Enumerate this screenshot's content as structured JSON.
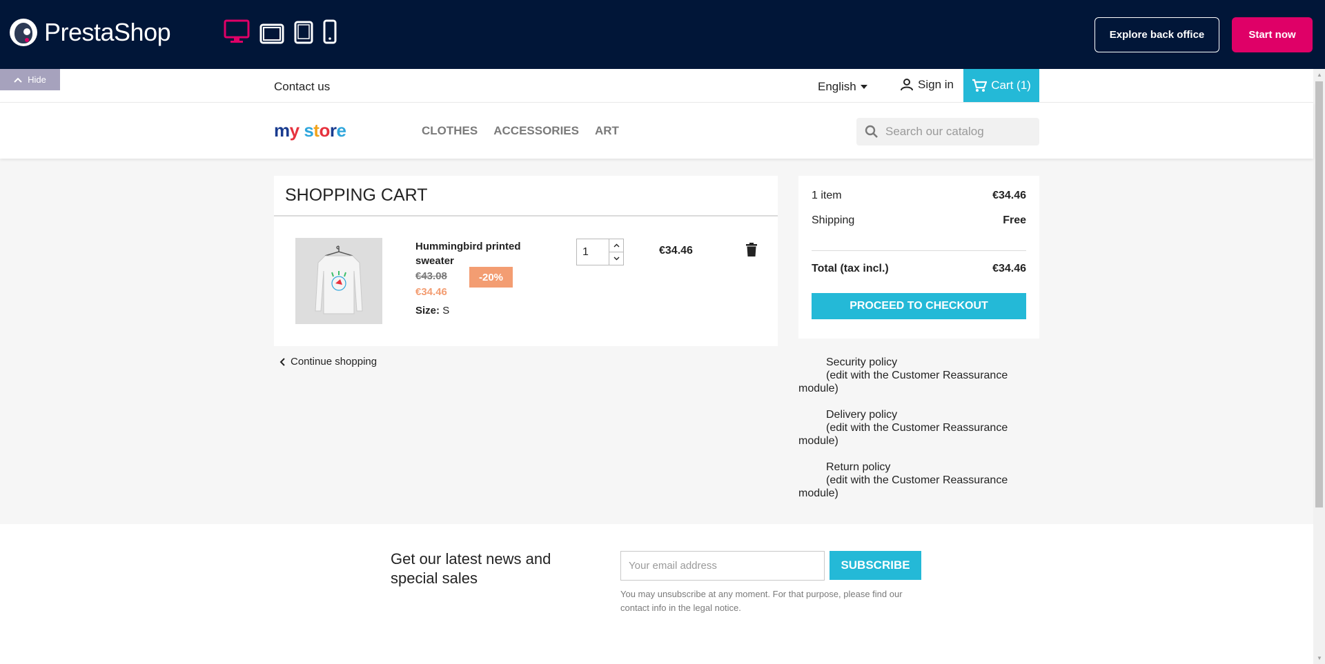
{
  "demo_bar": {
    "brand": "PrestaShop",
    "devices": [
      "desktop-icon",
      "laptop-icon",
      "tablet-icon",
      "mobile-icon"
    ],
    "explore_label": "Explore back office",
    "start_label": "Start now",
    "hide_label": "Hide",
    "colors": {
      "bar": "#011638",
      "accent": "#df0067"
    }
  },
  "header": {
    "contact": "Contact us",
    "language": "English",
    "signin": "Sign in",
    "cart": "Cart (1)",
    "logo_text": "my store",
    "menu": [
      "CLOTHES",
      "ACCESSORIES",
      "ART"
    ],
    "search_placeholder": "Search our catalog",
    "accent": "#24b9d7"
  },
  "cart": {
    "title": "SHOPPING CART",
    "item": {
      "name": "Hummingbird printed sweater",
      "old_price": "€43.08",
      "discount": "-20%",
      "price": "€34.46",
      "size_label": "Size:",
      "size_value": "S",
      "quantity": "1",
      "line_total": "€34.46"
    },
    "continue": "Continue shopping"
  },
  "summary": {
    "items_label": "1 item",
    "items_value": "€34.46",
    "shipping_label": "Shipping",
    "shipping_value": "Free",
    "total_label": "Total (tax incl.)",
    "total_value": "€34.46",
    "checkout": "PROCEED TO CHECKOUT"
  },
  "reassurance": [
    {
      "title": "Security policy",
      "desc1": "(edit with the Customer Reassurance",
      "desc2": "module)"
    },
    {
      "title": "Delivery policy",
      "desc1": "(edit with the Customer Reassurance",
      "desc2": "module)"
    },
    {
      "title": "Return policy",
      "desc1": "(edit with the Customer Reassurance",
      "desc2": "module)"
    }
  ],
  "newsletter": {
    "title": "Get our latest news and special sales",
    "placeholder": "Your email address",
    "button": "SUBSCRIBE",
    "note": "You may unsubscribe at any moment. For that purpose, please find our contact info in the legal notice."
  }
}
